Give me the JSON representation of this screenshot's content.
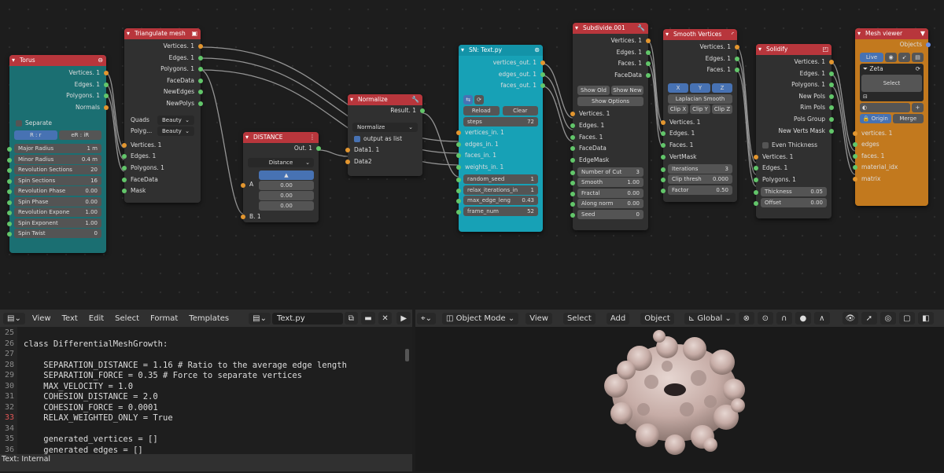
{
  "nodes": {
    "torus": {
      "title": "Torus",
      "outputs": [
        "Vertices. 1",
        "Edges. 1",
        "Polygons. 1",
        "Normals"
      ],
      "separate_label": "Separate",
      "toggle": [
        "R : r",
        "eR : iR"
      ],
      "fields": [
        {
          "label": "Major Radius",
          "value": "1 m"
        },
        {
          "label": "Minor Radius",
          "value": "0.4 m"
        },
        {
          "label": "Revolution Sections",
          "value": "20"
        },
        {
          "label": "Spin Sections",
          "value": "16"
        },
        {
          "label": "Revolution Phase",
          "value": "0.00"
        },
        {
          "label": "Spin Phase",
          "value": "0.00"
        },
        {
          "label": "Revolution Expone",
          "value": "1.00"
        },
        {
          "label": "Spin Exponent",
          "value": "1.00"
        },
        {
          "label": "Spin Twist",
          "value": "0"
        }
      ]
    },
    "triangulate": {
      "title": "Triangulate mesh",
      "outputs": [
        "Vertices. 1",
        "Edges. 1",
        "Polygons. 1",
        "FaceData",
        "NewEdges",
        "NewPolys"
      ],
      "quads_label": "Quads",
      "quads_value": "Beauty",
      "polyg_label": "Polyg...",
      "polyg_value": "Beauty",
      "inputs": [
        "Vertices. 1",
        "Edges. 1",
        "Polygons. 1",
        "FaceData",
        "Mask"
      ]
    },
    "distance": {
      "title": "DISTANCE",
      "output": "Out. 1",
      "mode": "Distance",
      "a_label": "A",
      "vals": [
        "0.00",
        "0.00",
        "0.00"
      ],
      "b_label": "B. 1"
    },
    "normalize": {
      "title": "Normalize",
      "output": "Result. 1",
      "mode": "Normalize",
      "output_as_list": "output as list",
      "inputs": [
        "Data1. 1",
        "Data2"
      ]
    },
    "sn_text": {
      "title": "SN: Text.py",
      "outputs": [
        "vertices_out. 1",
        "edges_out. 1",
        "faces_out. 1"
      ],
      "reload": "Reload",
      "clear": "Clear",
      "steps_label": "steps",
      "steps_value": "72",
      "inputs": [
        "vertices_in. 1",
        "edges_in. 1",
        "faces_in. 1",
        "weights_in. 1"
      ],
      "fields": [
        {
          "label": "random_seed",
          "value": "1"
        },
        {
          "label": "relax_iterations_in",
          "value": "1"
        },
        {
          "label": "max_edge_leng",
          "value": "0.43"
        },
        {
          "label": "frame_num",
          "value": "52"
        }
      ]
    },
    "subdivide": {
      "title": "Subdivide.001",
      "outputs": [
        "Vertices. 1",
        "Edges. 1",
        "Faces. 1",
        "FaceData"
      ],
      "show_old": "Show Old",
      "show_new": "Show New",
      "show_options": "Show Options",
      "inputs": [
        "Vertices. 1",
        "Edges. 1",
        "Faces. 1",
        "FaceData",
        "EdgeMask"
      ],
      "fields": [
        {
          "label": "Number of Cut",
          "value": "3"
        },
        {
          "label": "Smooth",
          "value": "1.00"
        },
        {
          "label": "Fractal",
          "value": "0.00"
        },
        {
          "label": "Along norm",
          "value": "0.00"
        },
        {
          "label": "Seed",
          "value": "0"
        }
      ]
    },
    "smooth": {
      "title": "Smooth Vertices",
      "outputs": [
        "Vertices. 1",
        "Edges. 1",
        "Faces. 1"
      ],
      "xyz": [
        "X",
        "Y",
        "Z"
      ],
      "laplacian": "Laplacian Smooth",
      "clips": [
        "Clip X",
        "Clip Y",
        "Clip Z"
      ],
      "inputs": [
        "Vertices. 1",
        "Edges. 1",
        "Faces. 1",
        "VertMask"
      ],
      "fields": [
        {
          "label": "Iterations",
          "value": "3"
        },
        {
          "label": "Clip thresh",
          "value": "0.000"
        },
        {
          "label": "Factor",
          "value": "0.50"
        }
      ]
    },
    "solidify": {
      "title": "Solidify",
      "outputs": [
        "Vertices. 1",
        "Edges. 1",
        "Polygons. 1",
        "New Pols",
        "Rim Pols",
        "Pols Group",
        "New Verts Mask"
      ],
      "even_thickness": "Even Thickness",
      "inputs": [
        "Vertices. 1",
        "Edges. 1",
        "Polygons. 1"
      ],
      "fields": [
        {
          "label": "Thickness",
          "value": "0.05"
        },
        {
          "label": "Offset",
          "value": "0.00"
        }
      ]
    },
    "viewer": {
      "title": "Mesh viewer",
      "output": "Objects",
      "live": "Live",
      "material": "Zeta",
      "select": "Select",
      "origin": "Origin",
      "merge": "Merge",
      "inputs": [
        "vertices. 1",
        "edges",
        "faces. 1",
        "material_idx",
        "matrix"
      ]
    }
  },
  "text_editor": {
    "menus": [
      "View",
      "Text",
      "Edit",
      "Select",
      "Format",
      "Templates"
    ],
    "file_name": "Text.py",
    "lines": [
      {
        "n": "25",
        "code": ""
      },
      {
        "n": "26",
        "code": "class DifferentialMeshGrowth:"
      },
      {
        "n": "27",
        "code": ""
      },
      {
        "n": "28",
        "code": "    SEPARATION_DISTANCE = 1.16 # Ratio to the average edge length"
      },
      {
        "n": "29",
        "code": "    SEPARATION_FORCE = 0.35 # Force to separate vertices"
      },
      {
        "n": "30",
        "code": "    MAX_VELOCITY = 1.0"
      },
      {
        "n": "31",
        "code": "    COHESION_DISTANCE = 2.0"
      },
      {
        "n": "32",
        "code": "    COHESION_FORCE = 0.0001"
      },
      {
        "n": "33",
        "code": "    RELAX_WEIGHTED_ONLY = True"
      },
      {
        "n": "34",
        "code": ""
      },
      {
        "n": "35",
        "code": "    generated_vertices = []"
      },
      {
        "n": "36",
        "code": "    generated_edges = []"
      }
    ],
    "status": "Text: Internal"
  },
  "viewport": {
    "mode": "Object Mode",
    "menus": [
      "View",
      "Select",
      "Add",
      "Object"
    ],
    "orientation": "Global"
  },
  "colors": {
    "node_header": "#b8363c",
    "teal_node": "#1b6f72",
    "cyan_node": "#17a1b6",
    "orange_node": "#c2791e",
    "socket_green": "#62c66a",
    "socket_orange": "#e3962f",
    "socket_blue": "#6a8ee4"
  }
}
